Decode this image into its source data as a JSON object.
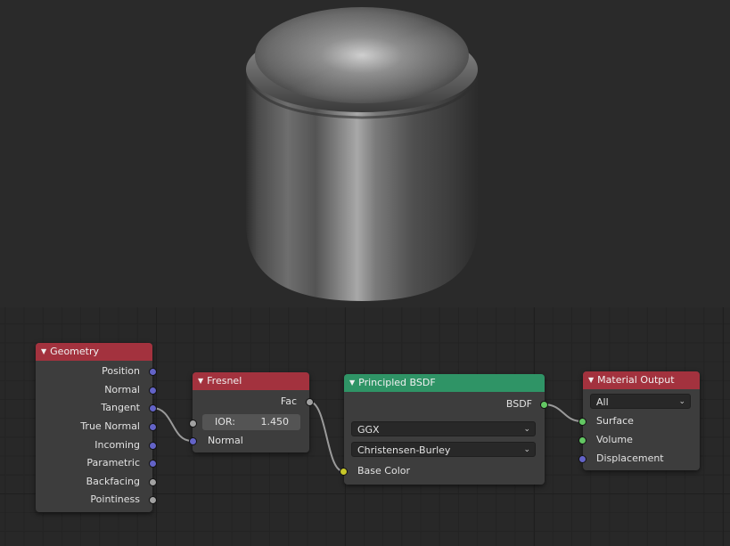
{
  "colors": {
    "node_header_red": "#a3323e",
    "node_header_green": "#2f9466",
    "socket_vector": "#6363c7",
    "socket_float": "#a1a1a1",
    "socket_shader": "#63c763",
    "socket_color": "#c7c729"
  },
  "viewport": {
    "object": "cylinder-render"
  },
  "nodes": {
    "geometry": {
      "title": "Geometry",
      "outputs": [
        "Position",
        "Normal",
        "Tangent",
        "True Normal",
        "Incoming",
        "Parametric",
        "Backfacing",
        "Pointiness"
      ]
    },
    "fresnel": {
      "title": "Fresnel",
      "output": "Fac",
      "ior_label": "IOR:",
      "ior_value": "1.450",
      "input": "Normal"
    },
    "principled": {
      "title": "Principled BSDF",
      "output": "BSDF",
      "distribution": "GGX",
      "subsurface": "Christensen-Burley",
      "input": "Base Color"
    },
    "output": {
      "title": "Material Output",
      "target": "All",
      "inputs": [
        "Surface",
        "Volume",
        "Displacement"
      ]
    }
  }
}
